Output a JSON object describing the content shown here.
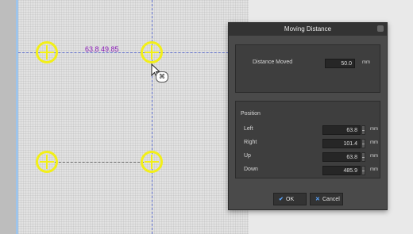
{
  "canvas": {
    "measurement_text": "63.8 49.85",
    "mark_color": "#f2ef18",
    "guide_color": "#5e6ecc",
    "icons": [
      "crosshair-target",
      "mouse-pointer",
      "move-handle"
    ]
  },
  "dialog": {
    "title": "Moving Distance",
    "distance": {
      "label": "Distance Moved",
      "value": "50.0",
      "unit": "mm"
    },
    "position": {
      "heading": "Position",
      "fields": [
        {
          "label": "Left",
          "value": "63.8",
          "unit": "mm"
        },
        {
          "label": "Right",
          "value": "101.4",
          "unit": "mm"
        },
        {
          "label": "Up",
          "value": "63.8",
          "unit": "mm"
        },
        {
          "label": "Down",
          "value": "485.9",
          "unit": "mm"
        }
      ]
    },
    "buttons": {
      "ok": "OK",
      "cancel": "Cancel"
    }
  }
}
